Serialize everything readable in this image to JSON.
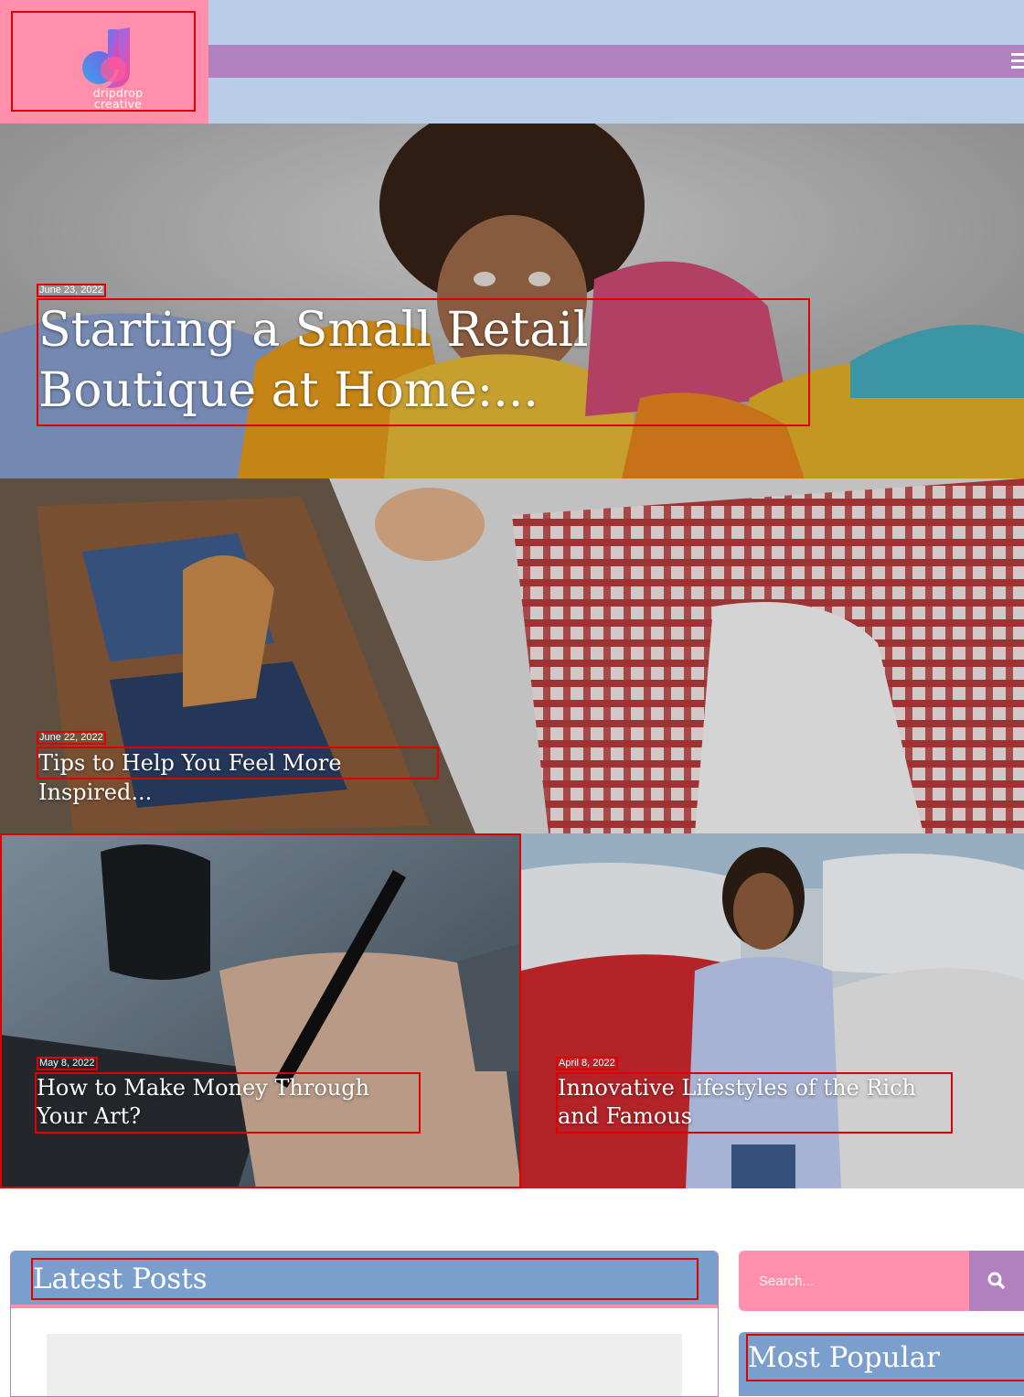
{
  "header": {
    "logo": {
      "line1": "dripdrop",
      "line2": "creative"
    },
    "menu_icon": "hamburger-menu-icon"
  },
  "featured": [
    {
      "date": "June 23, 2022",
      "title": "Starting a Small Retail Boutique at Home:..."
    },
    {
      "date": "June 22, 2022",
      "title": "Tips to Help You Feel More Inspired..."
    },
    {
      "date": "May 8, 2022",
      "title": "How to Make Money Through Your Art?"
    },
    {
      "date": "April 8, 2022",
      "title": "Innovative Lifestyles of the Rich and Famous"
    }
  ],
  "latest": {
    "heading": "Latest Posts"
  },
  "sidebar": {
    "search": {
      "placeholder": "Search...",
      "icon": "search-icon"
    },
    "popular_heading": "Most Popular"
  },
  "colors": {
    "header_bg": "#b9cde6",
    "logo_bg": "#ff8fab",
    "nav_bar": "#b181bf",
    "section_head": "#7b9fcd",
    "accent_pink": "#ff8fab"
  }
}
